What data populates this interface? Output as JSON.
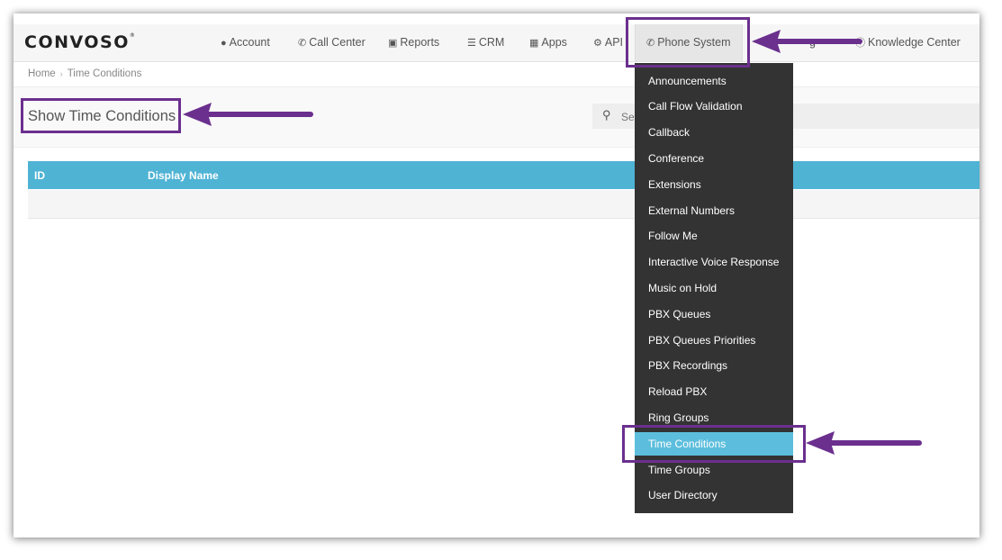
{
  "brand": {
    "logo": "CONVOSO",
    "trademark": "®"
  },
  "nav": {
    "items": [
      {
        "label": "Account",
        "icon": "user-icon"
      },
      {
        "label": "Call Center",
        "icon": "phone-icon"
      },
      {
        "label": "Reports",
        "icon": "bar-chart-icon"
      },
      {
        "label": "CRM",
        "icon": "list-icon"
      },
      {
        "label": "Apps",
        "icon": "grid-icon"
      },
      {
        "label": "API",
        "icon": "gear-icon"
      },
      {
        "label": "Phone System",
        "icon": "phone-icon"
      },
      {
        "label": "g",
        "icon": ""
      },
      {
        "label": "Knowledge Center",
        "icon": "help-icon"
      }
    ]
  },
  "breadcrumb": {
    "home": "Home",
    "current": "Time Conditions"
  },
  "page": {
    "title": "Show Time Conditions"
  },
  "search": {
    "placeholder": "Se"
  },
  "table": {
    "columns": [
      "ID",
      "Display Name"
    ]
  },
  "dropdown": {
    "items": [
      "Announcements",
      "Call Flow Validation",
      "Callback",
      "Conference",
      "Extensions",
      "External Numbers",
      "Follow Me",
      "Interactive Voice Response",
      "Music on Hold",
      "PBX Queues",
      "PBX Queues Priorities",
      "PBX Recordings",
      "Reload PBX",
      "Ring Groups",
      "Time Conditions",
      "Time Groups",
      "User Directory"
    ],
    "selected_index": 14
  },
  "colors": {
    "accent": "#4fb3d4",
    "selected": "#5cbedc",
    "annotation": "#6b2f8e",
    "dropdown_bg": "#333333"
  }
}
